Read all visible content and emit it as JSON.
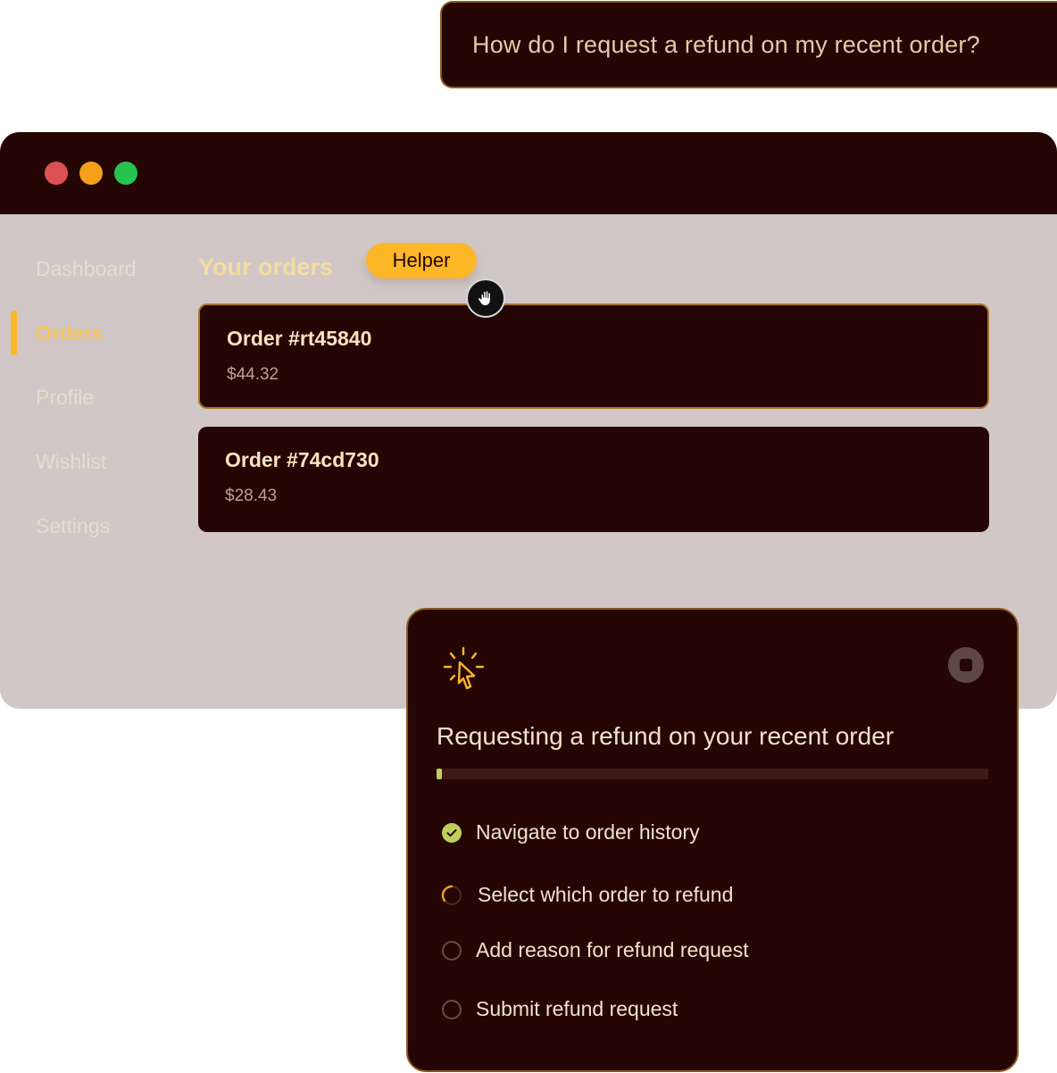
{
  "prompt": {
    "text": "How do I request a refund on my recent order?"
  },
  "window": {
    "traffic_lights": {
      "close_color": "#de5152",
      "minimize_color": "#f4a019",
      "zoom_color": "#27c34f"
    }
  },
  "sidebar": {
    "active_index": 1,
    "items": [
      {
        "label": "Dashboard"
      },
      {
        "label": "Orders"
      },
      {
        "label": "Profile"
      },
      {
        "label": "Wishlist"
      },
      {
        "label": "Settings"
      }
    ]
  },
  "main": {
    "title": "Your orders",
    "orders": [
      {
        "name": "Order #rt45840",
        "price": "$44.32",
        "highlighted": true
      },
      {
        "name": "Order #74cd730",
        "price": "$28.43",
        "highlighted": false
      }
    ]
  },
  "helper": {
    "label": "Helper",
    "cursor_icon": "hand-cursor-icon"
  },
  "task_panel": {
    "icon": "click-spark-icon",
    "stop_icon": "stop-icon",
    "title": "Requesting a refund on your recent order",
    "progress": 0.01,
    "steps": [
      {
        "label": "Navigate to order history",
        "status": "done"
      },
      {
        "label": "Select which order to refund",
        "status": "in-progress"
      },
      {
        "label": "Add reason for refund request",
        "status": "pending"
      },
      {
        "label": "Submit refund request",
        "status": "pending"
      }
    ]
  },
  "colors": {
    "dark": "#250605",
    "accent": "#fbb726",
    "success": "#c0cf5b",
    "window_bg": "#d1c7c6"
  }
}
